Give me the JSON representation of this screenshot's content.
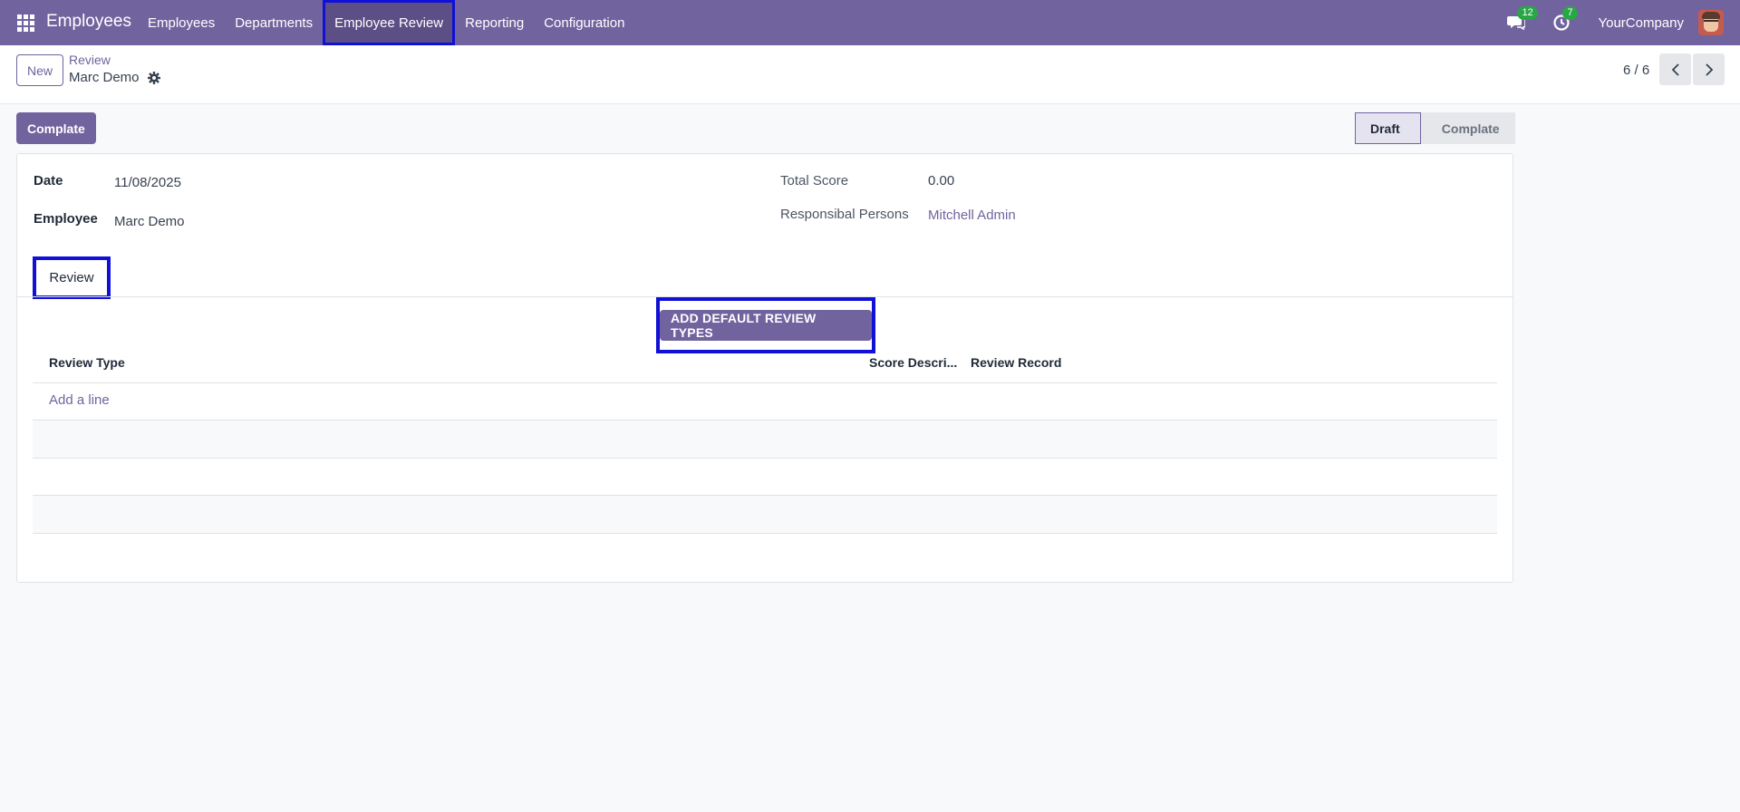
{
  "navbar": {
    "app_name": "Employees",
    "menu": [
      {
        "label": "Employees"
      },
      {
        "label": "Departments"
      },
      {
        "label": "Employee Review"
      },
      {
        "label": "Reporting"
      },
      {
        "label": "Configuration"
      }
    ],
    "messages_count": "12",
    "activities_count": "7",
    "company": "YourCompany"
  },
  "control": {
    "new_label": "New",
    "breadcrumb": "Review",
    "record_name": "Marc Demo",
    "pager": "6 / 6"
  },
  "status": {
    "action_label": "Complate",
    "stages": [
      {
        "label": "Draft",
        "active": true
      },
      {
        "label": "Complate",
        "active": false
      }
    ]
  },
  "form": {
    "date_label": "Date",
    "date_value": "11/08/2025",
    "employee_label": "Employee",
    "employee_value": "Marc Demo",
    "total_score_label": "Total Score",
    "total_score_value": "0.00",
    "responsible_label": "Responsibal Persons",
    "responsible_value": "Mitchell Admin"
  },
  "tabs": {
    "review": "Review"
  },
  "review_lines": {
    "action_button": "ADD DEFAULT REVIEW TYPES",
    "columns": [
      "Review Type",
      "Score Descri...",
      "Review Record"
    ],
    "add_line": "Add a line"
  },
  "colors": {
    "brand": "#71639e",
    "highlight": "#1010d6",
    "badge": "#28a745"
  }
}
